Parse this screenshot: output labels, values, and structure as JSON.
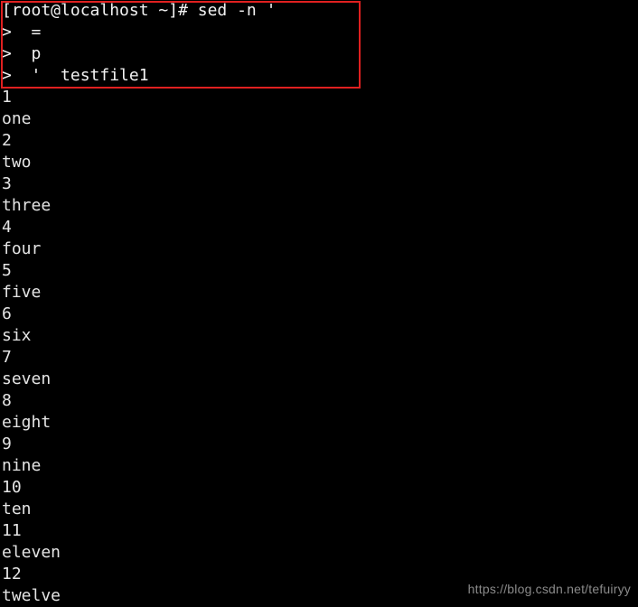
{
  "terminal": {
    "background_color": "#000000",
    "text_color": "#e8e8e8",
    "highlight_border_color": "#e02020",
    "command_block": [
      "[root@localhost ~]# sed -n '",
      ">  =",
      ">  p",
      ">  '  testfile1"
    ],
    "output_lines": [
      "1",
      "one",
      "2",
      "two",
      "3",
      "three",
      "4",
      "four",
      "5",
      "five",
      "6",
      "six",
      "7",
      "seven",
      "8",
      "eight",
      "9",
      "nine",
      "10",
      "ten",
      "11",
      "eleven",
      "12",
      "twelve"
    ]
  },
  "watermark": {
    "text": "https://blog.csdn.net/tefuiryy",
    "color": "#8a8a8a"
  }
}
